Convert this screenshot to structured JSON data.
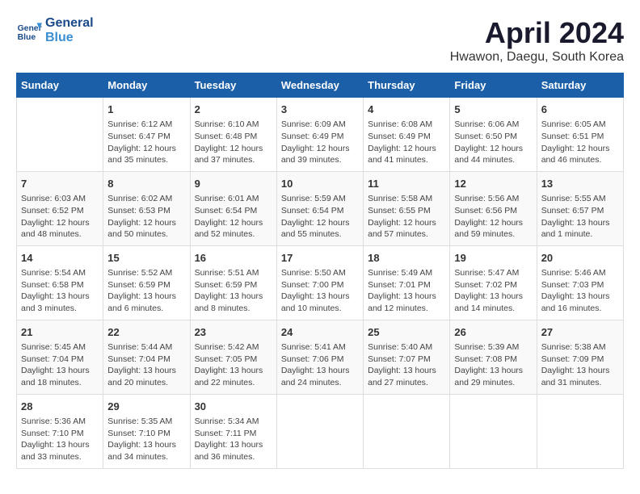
{
  "header": {
    "logo_line1": "General",
    "logo_line2": "Blue",
    "title": "April 2024",
    "subtitle": "Hwawon, Daegu, South Korea"
  },
  "calendar": {
    "days_of_week": [
      "Sunday",
      "Monday",
      "Tuesday",
      "Wednesday",
      "Thursday",
      "Friday",
      "Saturday"
    ],
    "weeks": [
      [
        {
          "num": "",
          "content": ""
        },
        {
          "num": "1",
          "content": "Sunrise: 6:12 AM\nSunset: 6:47 PM\nDaylight: 12 hours\nand 35 minutes."
        },
        {
          "num": "2",
          "content": "Sunrise: 6:10 AM\nSunset: 6:48 PM\nDaylight: 12 hours\nand 37 minutes."
        },
        {
          "num": "3",
          "content": "Sunrise: 6:09 AM\nSunset: 6:49 PM\nDaylight: 12 hours\nand 39 minutes."
        },
        {
          "num": "4",
          "content": "Sunrise: 6:08 AM\nSunset: 6:49 PM\nDaylight: 12 hours\nand 41 minutes."
        },
        {
          "num": "5",
          "content": "Sunrise: 6:06 AM\nSunset: 6:50 PM\nDaylight: 12 hours\nand 44 minutes."
        },
        {
          "num": "6",
          "content": "Sunrise: 6:05 AM\nSunset: 6:51 PM\nDaylight: 12 hours\nand 46 minutes."
        }
      ],
      [
        {
          "num": "7",
          "content": "Sunrise: 6:03 AM\nSunset: 6:52 PM\nDaylight: 12 hours\nand 48 minutes."
        },
        {
          "num": "8",
          "content": "Sunrise: 6:02 AM\nSunset: 6:53 PM\nDaylight: 12 hours\nand 50 minutes."
        },
        {
          "num": "9",
          "content": "Sunrise: 6:01 AM\nSunset: 6:54 PM\nDaylight: 12 hours\nand 52 minutes."
        },
        {
          "num": "10",
          "content": "Sunrise: 5:59 AM\nSunset: 6:54 PM\nDaylight: 12 hours\nand 55 minutes."
        },
        {
          "num": "11",
          "content": "Sunrise: 5:58 AM\nSunset: 6:55 PM\nDaylight: 12 hours\nand 57 minutes."
        },
        {
          "num": "12",
          "content": "Sunrise: 5:56 AM\nSunset: 6:56 PM\nDaylight: 12 hours\nand 59 minutes."
        },
        {
          "num": "13",
          "content": "Sunrise: 5:55 AM\nSunset: 6:57 PM\nDaylight: 13 hours\nand 1 minute."
        }
      ],
      [
        {
          "num": "14",
          "content": "Sunrise: 5:54 AM\nSunset: 6:58 PM\nDaylight: 13 hours\nand 3 minutes."
        },
        {
          "num": "15",
          "content": "Sunrise: 5:52 AM\nSunset: 6:59 PM\nDaylight: 13 hours\nand 6 minutes."
        },
        {
          "num": "16",
          "content": "Sunrise: 5:51 AM\nSunset: 6:59 PM\nDaylight: 13 hours\nand 8 minutes."
        },
        {
          "num": "17",
          "content": "Sunrise: 5:50 AM\nSunset: 7:00 PM\nDaylight: 13 hours\nand 10 minutes."
        },
        {
          "num": "18",
          "content": "Sunrise: 5:49 AM\nSunset: 7:01 PM\nDaylight: 13 hours\nand 12 minutes."
        },
        {
          "num": "19",
          "content": "Sunrise: 5:47 AM\nSunset: 7:02 PM\nDaylight: 13 hours\nand 14 minutes."
        },
        {
          "num": "20",
          "content": "Sunrise: 5:46 AM\nSunset: 7:03 PM\nDaylight: 13 hours\nand 16 minutes."
        }
      ],
      [
        {
          "num": "21",
          "content": "Sunrise: 5:45 AM\nSunset: 7:04 PM\nDaylight: 13 hours\nand 18 minutes."
        },
        {
          "num": "22",
          "content": "Sunrise: 5:44 AM\nSunset: 7:04 PM\nDaylight: 13 hours\nand 20 minutes."
        },
        {
          "num": "23",
          "content": "Sunrise: 5:42 AM\nSunset: 7:05 PM\nDaylight: 13 hours\nand 22 minutes."
        },
        {
          "num": "24",
          "content": "Sunrise: 5:41 AM\nSunset: 7:06 PM\nDaylight: 13 hours\nand 24 minutes."
        },
        {
          "num": "25",
          "content": "Sunrise: 5:40 AM\nSunset: 7:07 PM\nDaylight: 13 hours\nand 27 minutes."
        },
        {
          "num": "26",
          "content": "Sunrise: 5:39 AM\nSunset: 7:08 PM\nDaylight: 13 hours\nand 29 minutes."
        },
        {
          "num": "27",
          "content": "Sunrise: 5:38 AM\nSunset: 7:09 PM\nDaylight: 13 hours\nand 31 minutes."
        }
      ],
      [
        {
          "num": "28",
          "content": "Sunrise: 5:36 AM\nSunset: 7:10 PM\nDaylight: 13 hours\nand 33 minutes."
        },
        {
          "num": "29",
          "content": "Sunrise: 5:35 AM\nSunset: 7:10 PM\nDaylight: 13 hours\nand 34 minutes."
        },
        {
          "num": "30",
          "content": "Sunrise: 5:34 AM\nSunset: 7:11 PM\nDaylight: 13 hours\nand 36 minutes."
        },
        {
          "num": "",
          "content": ""
        },
        {
          "num": "",
          "content": ""
        },
        {
          "num": "",
          "content": ""
        },
        {
          "num": "",
          "content": ""
        }
      ]
    ]
  }
}
